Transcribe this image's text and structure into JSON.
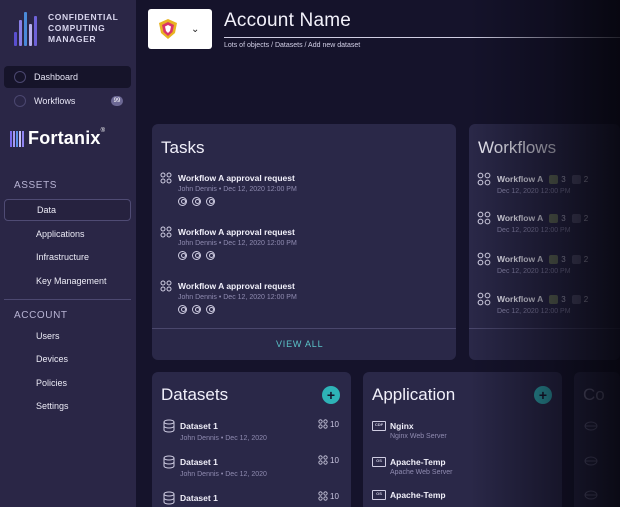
{
  "app": {
    "name_lines": [
      "CONFIDENTIAL",
      "COMPUTING",
      "MANAGER"
    ],
    "logo_bars": [
      "#5a4fcf",
      "#8a7fe6",
      "#4a8ad8",
      "#b8b0f0",
      "#6e62d8"
    ]
  },
  "nav": {
    "dashboard": "Dashboard",
    "workflows": "Workflows",
    "workflows_badge": "99"
  },
  "fortanix": {
    "name": "Fortanix",
    "tm": "®"
  },
  "assets": {
    "heading": "ASSETS",
    "items": [
      "Data",
      "Applications",
      "Infrastructure",
      "Key Management"
    ]
  },
  "account": {
    "heading": "ACCOUNT",
    "items": [
      "Users",
      "Devices",
      "Policies",
      "Settings"
    ]
  },
  "header": {
    "title": "Account Name",
    "breadcrumb": "Lots of objects / Datasets / Add new dataset",
    "chevron": "⌄"
  },
  "tasks": {
    "title": "Tasks",
    "items": [
      {
        "title": "Workflow A approval request",
        "meta": "John Dennis  •  Dec 12, 2020 12:00 PM"
      },
      {
        "title": "Workflow A approval request",
        "meta": "John Dennis  •  Dec 12, 2020 12:00 PM"
      },
      {
        "title": "Workflow A approval request",
        "meta": "John Dennis  •  Dec 12, 2020 12:00 PM"
      }
    ],
    "view_all": "VIEW ALL"
  },
  "workflows": {
    "title": "Workflows",
    "items": [
      {
        "title": "Workflow A",
        "count1": "3",
        "count2": "2",
        "meta": "Dec 12, 2020 12:00 PM"
      },
      {
        "title": "Workflow A",
        "count1": "3",
        "count2": "2",
        "meta": "Dec 12, 2020 12:00 PM"
      },
      {
        "title": "Workflow A",
        "count1": "3",
        "count2": "2",
        "meta": "Dec 12, 2020 12:00 PM"
      },
      {
        "title": "Workflow A",
        "count1": "3",
        "count2": "2",
        "meta": "Dec 12, 2020 12:00 PM"
      }
    ]
  },
  "datasets": {
    "title": "Datasets",
    "plus": "+",
    "items": [
      {
        "title": "Dataset 1",
        "meta": "John Dennis  •  Dec 12, 2020",
        "count": "10"
      },
      {
        "title": "Dataset 1",
        "meta": "John Dennis  •  Dec 12, 2020",
        "count": "10"
      },
      {
        "title": "Dataset 1",
        "meta": "",
        "count": "10"
      }
    ]
  },
  "application": {
    "title": "Application",
    "plus": "+",
    "items": [
      {
        "title": "Nginx",
        "tag": "CDF",
        "meta": "Nginx Web Server"
      },
      {
        "title": "Apache-Temp",
        "tag": "OS",
        "meta": "Apache Web Server"
      },
      {
        "title": "Apache-Temp",
        "tag": "OS",
        "meta": ""
      }
    ]
  },
  "third_card": {
    "title": "Co"
  },
  "colors": {
    "sidebar": "#2a2646",
    "background": "#15132b",
    "card": "#2a2848",
    "accent": "#2eb3b7",
    "muted_text": "#8f8bb0"
  }
}
